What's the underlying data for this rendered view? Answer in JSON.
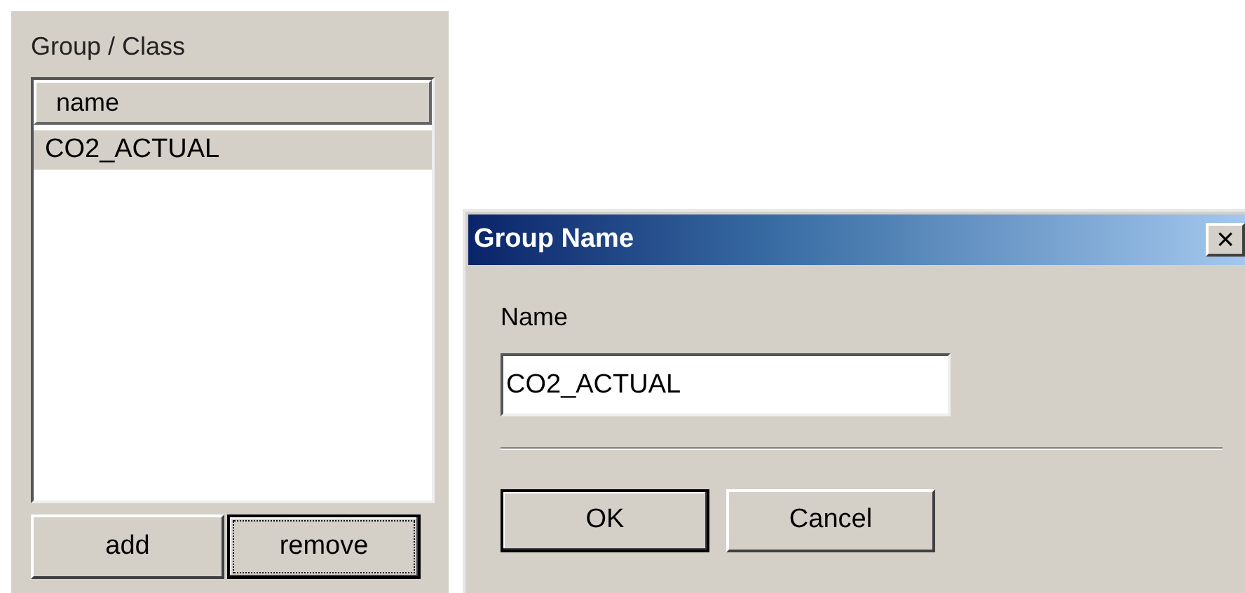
{
  "panel": {
    "title": "Group / Class",
    "list": {
      "column": "name",
      "rows": [
        {
          "label": "CO2_ACTUAL",
          "selected": true
        }
      ]
    },
    "buttons": [
      {
        "label": "add",
        "default": false,
        "focused": false
      },
      {
        "label": "remove",
        "default": true,
        "focused": true
      }
    ]
  },
  "dialog": {
    "title": "Group Name",
    "close": "×",
    "field": {
      "label": "Name",
      "value": "CO2_ACTUAL"
    },
    "buttons": [
      {
        "label": "OK",
        "default": true,
        "focused": false
      },
      {
        "label": "Cancel",
        "default": false,
        "focused": false
      }
    ]
  }
}
